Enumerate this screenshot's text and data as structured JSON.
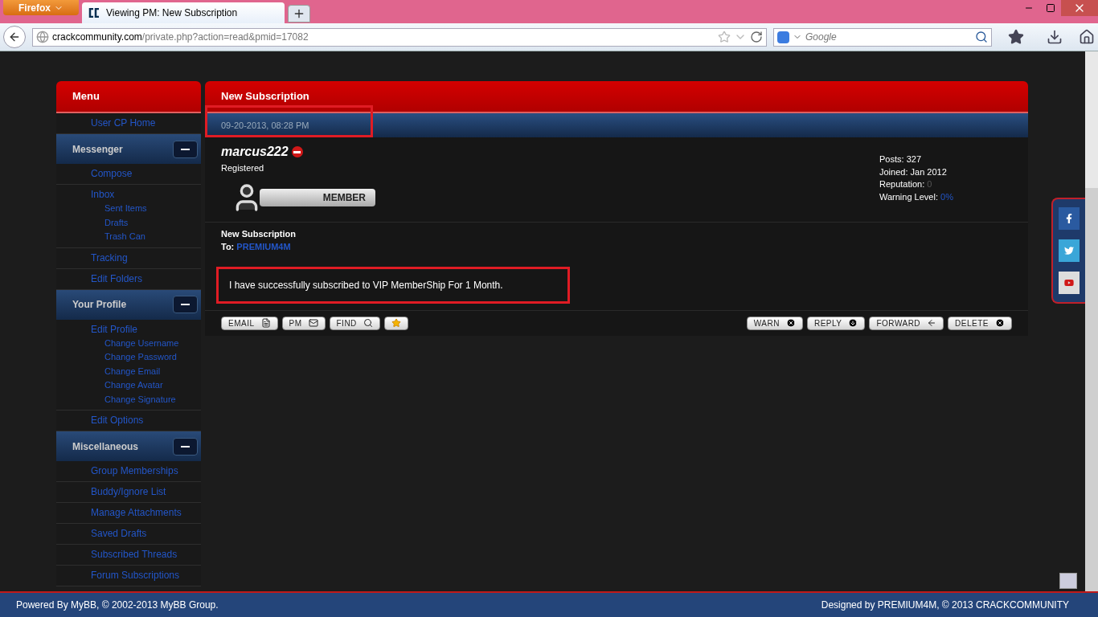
{
  "browser": {
    "menu_button": "Firefox",
    "tab_title": "Viewing PM: New Subscription",
    "url_host": "crackcommunity.com",
    "url_path": "/private.php?action=read&pmid=17082",
    "search_placeholder": "Google"
  },
  "sidebar": {
    "title": "Menu",
    "groups": [
      {
        "items": [
          {
            "label": "User CP Home"
          }
        ]
      },
      {
        "header": "Messenger",
        "expanded": true,
        "items": [
          {
            "label": "Compose"
          },
          {
            "label": "Inbox",
            "children": [
              {
                "label": "Sent Items"
              },
              {
                "label": "Drafts"
              },
              {
                "label": "Trash Can"
              }
            ]
          },
          {
            "label": "Tracking"
          },
          {
            "label": "Edit Folders"
          }
        ]
      },
      {
        "header": "Your Profile",
        "expanded": true,
        "items": [
          {
            "label": "Edit Profile",
            "children": [
              {
                "label": "Change Username"
              },
              {
                "label": "Change Password"
              },
              {
                "label": "Change Email"
              },
              {
                "label": "Change Avatar"
              },
              {
                "label": "Change Signature"
              }
            ]
          },
          {
            "label": "Edit Options"
          }
        ]
      },
      {
        "header": "Miscellaneous",
        "expanded": true,
        "items": [
          {
            "label": "Group Memberships"
          },
          {
            "label": "Buddy/Ignore List"
          },
          {
            "label": "Manage Attachments"
          },
          {
            "label": "Saved Drafts"
          },
          {
            "label": "Subscribed Threads"
          },
          {
            "label": "Forum Subscriptions"
          }
        ]
      }
    ]
  },
  "post": {
    "title": "New Subscription",
    "date": "09-20-2013, 08:28 PM",
    "date_highlighted": true,
    "author": "marcus222",
    "online": false,
    "user_title": "Registered",
    "rank_badge": "MEMBER",
    "stats": [
      {
        "label": "Posts:",
        "value": "327",
        "kind": "plain"
      },
      {
        "label": "Joined:",
        "value": "Jan 2012",
        "kind": "plain"
      },
      {
        "label": "Reputation:",
        "value": "0",
        "kind": "muted"
      },
      {
        "label": "Warning Level:",
        "value": "0%",
        "kind": "link"
      }
    ],
    "subject": "New Subscription",
    "to_label": "To:",
    "recipient": "PREMIUM4M",
    "message": "I have successfully subscribed to VIP MemberShip For 1 Month.",
    "message_highlighted": true,
    "left_buttons": [
      {
        "label": "EMAIL",
        "kind": "file"
      },
      {
        "label": "PM",
        "kind": "mail"
      },
      {
        "label": "FIND",
        "kind": "search"
      },
      {
        "kind": "star"
      }
    ],
    "right_buttons": [
      {
        "label": "WARN",
        "kind": "x"
      },
      {
        "label": "REPLY",
        "kind": "down"
      },
      {
        "label": "FORWARD",
        "kind": "left"
      },
      {
        "label": "DELETE",
        "kind": "x"
      }
    ]
  },
  "footer": {
    "left": "Powered By MyBB, © 2002-2013 MyBB Group.",
    "right": "Designed by PREMIUM4M, © 2013 CRACKCOMMUNITY"
  }
}
